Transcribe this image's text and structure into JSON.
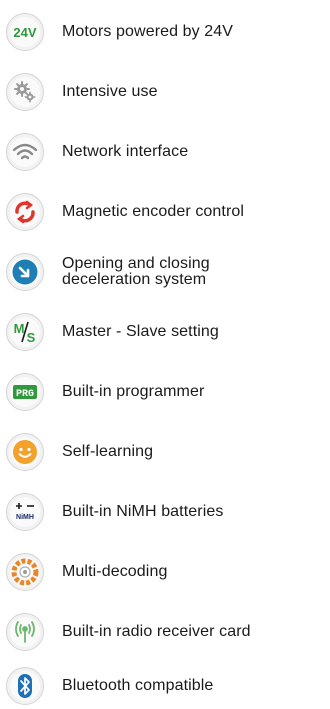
{
  "features": [
    {
      "label": "Motors powered by 24V",
      "icon": "24v-icon",
      "icon_text": "24V",
      "color": "#2e9a3c"
    },
    {
      "label": "Intensive use",
      "icon": "gears-icon",
      "color": "#9a9a9a"
    },
    {
      "label": "Network interface",
      "icon": "wifi-icon",
      "color": "#8a8a8a"
    },
    {
      "label": "Magnetic encoder control",
      "icon": "refresh-icon",
      "color": "#e0342c"
    },
    {
      "label": "Opening and closing deceleration system",
      "icon": "deceleration-icon",
      "color": "#1f7fb4"
    },
    {
      "label": "Master - Slave setting",
      "icon": "master-slave-icon",
      "icon_text_m": "M",
      "icon_text_s": "S",
      "color": "#2e9a3c"
    },
    {
      "label": "Built-in programmer",
      "icon": "programmer-icon",
      "icon_text": "PRG",
      "color": "#2e9a3c"
    },
    {
      "label": "Self-learning",
      "icon": "smiley-icon",
      "color": "#f2a12a"
    },
    {
      "label": "Built-in NiMH batteries",
      "icon": "battery-icon",
      "icon_text": "NiMH",
      "color": "#1c2a6b"
    },
    {
      "label": "Multi-decoding",
      "icon": "multi-decoding-icon",
      "color": "#e8862a"
    },
    {
      "label": "Built-in radio receiver card",
      "icon": "radio-icon",
      "color": "#6bb86b"
    },
    {
      "label": "Bluetooth compatible",
      "icon": "bluetooth-icon",
      "color": "#1f6fb4"
    }
  ]
}
